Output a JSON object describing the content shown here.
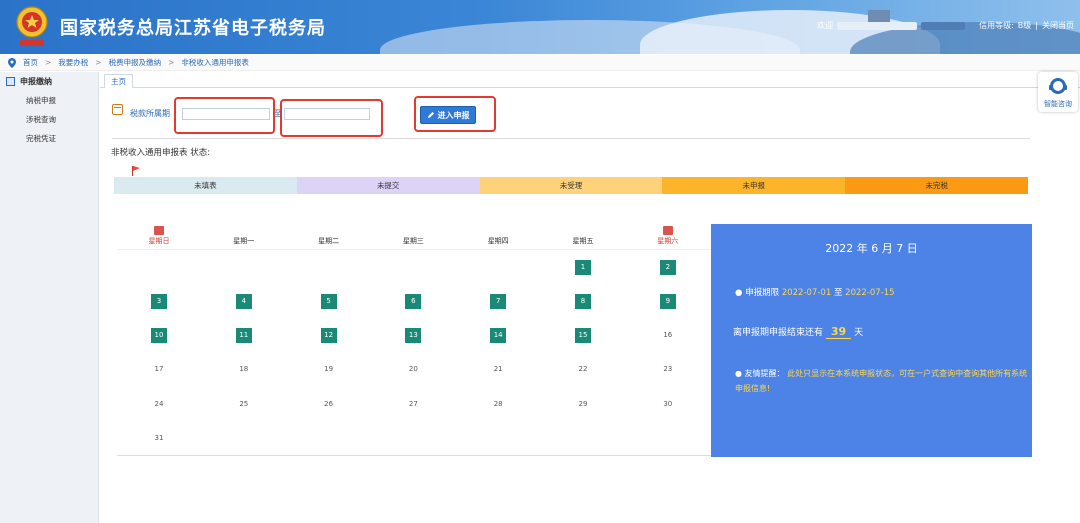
{
  "header": {
    "title": "国家税务总局江苏省电子税务局",
    "welcome": "欢迎",
    "credit_label": "信用等级:",
    "credit_value": "B级",
    "separator": "|",
    "close_label": "关闭当页"
  },
  "breadcrumb": {
    "items": [
      "首页",
      "我要办税",
      "税费申报及缴纳",
      "非税收入通用申报表"
    ],
    "separator": ">"
  },
  "sidebar": {
    "heading": "申报缴纳",
    "items": [
      "纳税申报",
      "涉税查询",
      "完税凭证"
    ]
  },
  "tabs": [
    {
      "label": "主页"
    }
  ],
  "filter": {
    "period_label": "税款所属期",
    "to_label": "至",
    "start_value": "",
    "end_value": "",
    "enter_button": "进入申报"
  },
  "status": {
    "title": "非税收入通用申报表 状态:",
    "legend": [
      {
        "label": "未填表",
        "color": "#d9ebf0"
      },
      {
        "label": "未提交",
        "color": "#dcd3f7"
      },
      {
        "label": "未受理",
        "color": "#fdd27a"
      },
      {
        "label": "未申报",
        "color": "#fcb52b"
      },
      {
        "label": "未完税",
        "color": "#fb9a13"
      }
    ]
  },
  "calendar": {
    "weekdays": [
      "星期日",
      "星期一",
      "星期二",
      "星期三",
      "星期四",
      "星期五",
      "星期六"
    ],
    "days": [
      [
        "",
        "",
        "",
        "",
        "",
        "1",
        "2"
      ],
      [
        "3",
        "4",
        "5",
        "6",
        "7",
        "8",
        "9"
      ],
      [
        "10",
        "11",
        "12",
        "13",
        "14",
        "15",
        "16"
      ],
      [
        "17",
        "18",
        "19",
        "20",
        "21",
        "22",
        "23"
      ],
      [
        "24",
        "25",
        "26",
        "27",
        "28",
        "29",
        "30"
      ],
      [
        "31",
        "",
        "",
        "",
        "",
        "",
        ""
      ]
    ],
    "highlighted_through": 15,
    "highlight_color": "#1a8a76"
  },
  "info_panel": {
    "date": "2022 年 6 月 7 日",
    "period_label": "● 申报期限",
    "period_start": "2022-07-01",
    "period_to": "至",
    "period_end": "2022-07-15",
    "countdown_prefix": "离申报期申报结束还有",
    "countdown_value": "39",
    "countdown_suffix": "天",
    "tip_label": "● 友情提醒：",
    "tip_text": "此处只显示在本系统申报状态，可在一户式查询中查询其他所有系统申报信息!"
  },
  "help": {
    "label": "智能咨询"
  },
  "colors": {
    "accent": "#2f7ad8",
    "panel": "#4d82e6",
    "highlight_text": "#ffd84a",
    "annotation": "#e23a2f"
  }
}
